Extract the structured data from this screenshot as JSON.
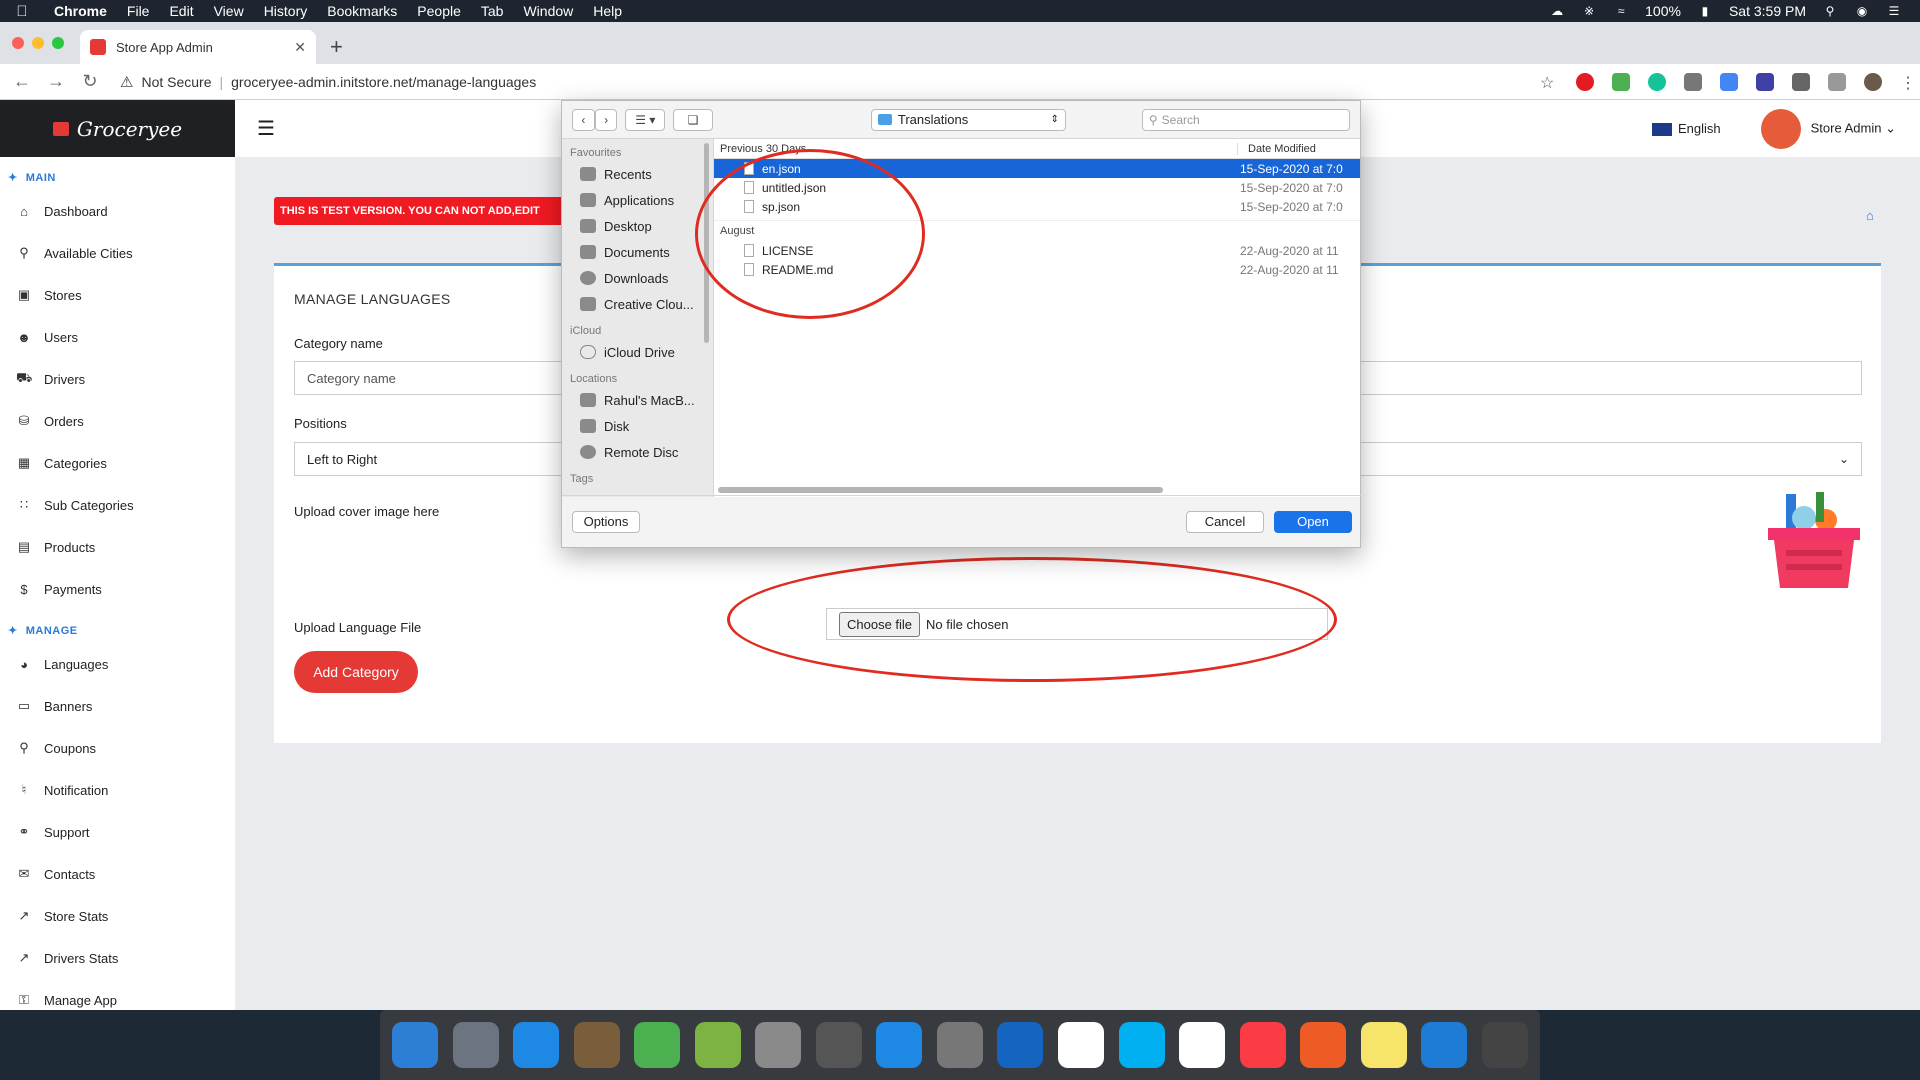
{
  "menubar": {
    "app": "Chrome",
    "items": [
      "File",
      "Edit",
      "View",
      "History",
      "Bookmarks",
      "People",
      "Tab",
      "Window",
      "Help"
    ],
    "battery": "100%",
    "clock": "Sat 3:59 PM"
  },
  "browser": {
    "tab_title": "Store App Admin",
    "security": "Not Secure",
    "url": "groceryee-admin.initstore.net/manage-languages"
  },
  "sidebar": {
    "brand": "Groceryee",
    "main_title": "MAIN",
    "main_items": [
      {
        "label": "Dashboard",
        "icon": "home-icon"
      },
      {
        "label": "Available Cities",
        "icon": "map-pin-icon"
      },
      {
        "label": "Stores",
        "icon": "store-icon"
      },
      {
        "label": "Users",
        "icon": "user-icon"
      },
      {
        "label": "Drivers",
        "icon": "truck-icon"
      },
      {
        "label": "Orders",
        "icon": "cart-icon"
      },
      {
        "label": "Categories",
        "icon": "grid-icon"
      },
      {
        "label": "Sub Categories",
        "icon": "sub-grid-icon"
      },
      {
        "label": "Products",
        "icon": "product-icon"
      },
      {
        "label": "Payments",
        "icon": "dollar-icon"
      }
    ],
    "manage_title": "MANAGE",
    "manage_items": [
      {
        "label": "Languages",
        "icon": "globe-icon"
      },
      {
        "label": "Banners",
        "icon": "banner-icon"
      },
      {
        "label": "Coupons",
        "icon": "coupon-icon"
      },
      {
        "label": "Notification",
        "icon": "bell-icon"
      },
      {
        "label": "Support",
        "icon": "support-icon"
      },
      {
        "label": "Contacts",
        "icon": "mail-icon"
      },
      {
        "label": "Store Stats",
        "icon": "chart-icon"
      },
      {
        "label": "Drivers Stats",
        "icon": "chart-icon"
      },
      {
        "label": "Manage App",
        "icon": "lock-icon"
      }
    ]
  },
  "topbar": {
    "language": "English",
    "user": "Store Admin"
  },
  "banner_text": "THIS IS TEST VERSION. YOU CAN NOT ADD,EDIT",
  "form": {
    "title": "MANAGE LANGUAGES",
    "category_label": "Category name",
    "category_placeholder": "Category name",
    "positions_label": "Positions",
    "positions_value": "Left to Right",
    "cover_label": "Upload cover image here",
    "file_label": "Upload Language File",
    "choose_file": "Choose file",
    "no_file": "No file chosen",
    "submit": "Add Category"
  },
  "dialog": {
    "location": "Translations",
    "search_placeholder": "Search",
    "sidebar": {
      "favourites_title": "Favourites",
      "favourites": [
        "Recents",
        "Applications",
        "Desktop",
        "Documents",
        "Downloads",
        "Creative Clou..."
      ],
      "icloud_title": "iCloud",
      "icloud": [
        "iCloud Drive"
      ],
      "locations_title": "Locations",
      "locations": [
        "Rahul's MacB...",
        "Disk",
        "Remote Disc"
      ],
      "tags_title": "Tags"
    },
    "col_name": "Previous 30 Days",
    "col_date": "Date Modified",
    "recent_files": [
      {
        "name": "en.json",
        "date": "15-Sep-2020 at 7:0"
      },
      {
        "name": "untitled.json",
        "date": "15-Sep-2020 at 7:0"
      },
      {
        "name": "sp.json",
        "date": "15-Sep-2020 at 7:0"
      }
    ],
    "group_august": "August",
    "august_files": [
      {
        "name": "LICENSE",
        "date": "22-Aug-2020 at 11"
      },
      {
        "name": "README.md",
        "date": "22-Aug-2020 at 11"
      }
    ],
    "options": "Options",
    "cancel": "Cancel",
    "open": "Open"
  },
  "dock": {
    "apps": [
      "finder-icon",
      "launchpad-icon",
      "safari-icon",
      "preview-icon",
      "maps-icon",
      "android-studio-icon",
      "calculator-icon",
      "tableplus-icon",
      "app-store-icon",
      "system-preferences-icon",
      "xcode-icon",
      "slack-icon",
      "skype-icon",
      "chrome-icon",
      "music-icon",
      "postman-icon",
      "notes-icon",
      "vscode-icon",
      "trash-icon"
    ],
    "colors": [
      "#2d7fd6",
      "#6b7480",
      "#1e88e5",
      "#7a5d3b",
      "#4caf50",
      "#7cb342",
      "#8a8a8a",
      "#555555",
      "#1e88e5",
      "#777777",
      "#1565c0",
      "#ffffff",
      "#00aff0",
      "#ffffff",
      "#fc3c44",
      "#ef5b25",
      "#f7e46b",
      "#1e7bd6",
      "#444444"
    ]
  }
}
